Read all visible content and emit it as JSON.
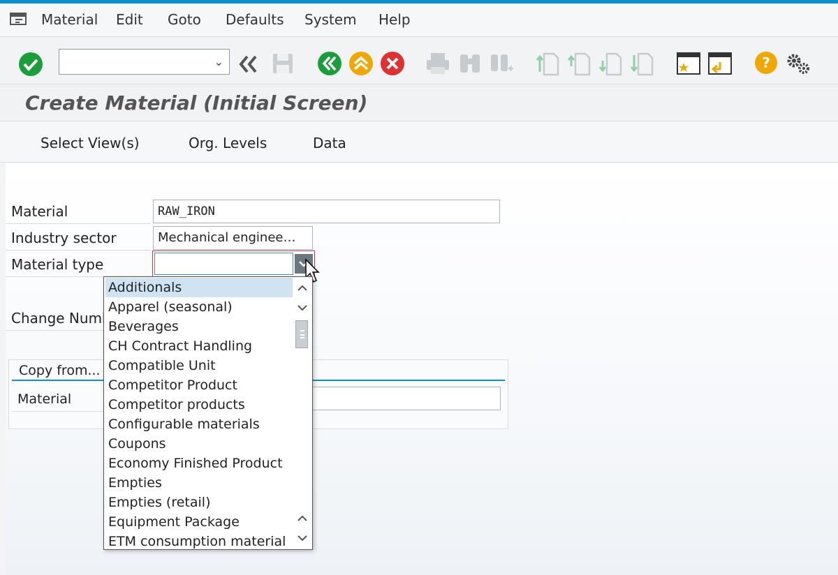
{
  "menu": {
    "items": [
      "Material",
      "Edit",
      "Goto",
      "Defaults",
      "System",
      "Help"
    ]
  },
  "toolbar": {
    "command_field_value": "",
    "icons": [
      "enter-icon",
      "back-double-icon",
      "save-icon",
      "back-icon",
      "exit-icon",
      "cancel-icon",
      "print-icon",
      "find-icon",
      "find-next-icon",
      "first-page-icon",
      "previous-page-icon",
      "next-page-icon",
      "last-page-icon",
      "create-session-icon",
      "shortcut-icon",
      "help-icon",
      "settings-icon"
    ]
  },
  "title": "Create Material (Initial Screen)",
  "app_toolbar": {
    "select_views": "Select View(s)",
    "org_levels": "Org. Levels",
    "data": "Data"
  },
  "form": {
    "material_label": "Material",
    "material_value": "RAW_IRON",
    "industry_label": "Industry sector",
    "industry_value": "Mechanical enginee…",
    "material_type_label": "Material type",
    "material_type_value": "",
    "change_number_label": "Change Numb"
  },
  "copy_from": {
    "title": "Copy from...",
    "material_label": "Material",
    "material_value": ""
  },
  "dropdown": {
    "options": [
      "Additionals",
      "Apparel (seasonal)",
      "Beverages",
      "CH Contract Handling",
      "Compatible Unit",
      "Competitor Product",
      "Competitor products",
      "Configurable materials",
      "Coupons",
      "Economy Finished Product",
      "Empties",
      "Empties (retail)",
      "Equipment Package",
      "ETM consumption material"
    ],
    "selected_index": 0
  },
  "colors": {
    "accent": "#0a8fd6",
    "enter_green": "#1a9e3a",
    "nav_orange": "#f0a800",
    "cancel_red": "#e03030"
  }
}
